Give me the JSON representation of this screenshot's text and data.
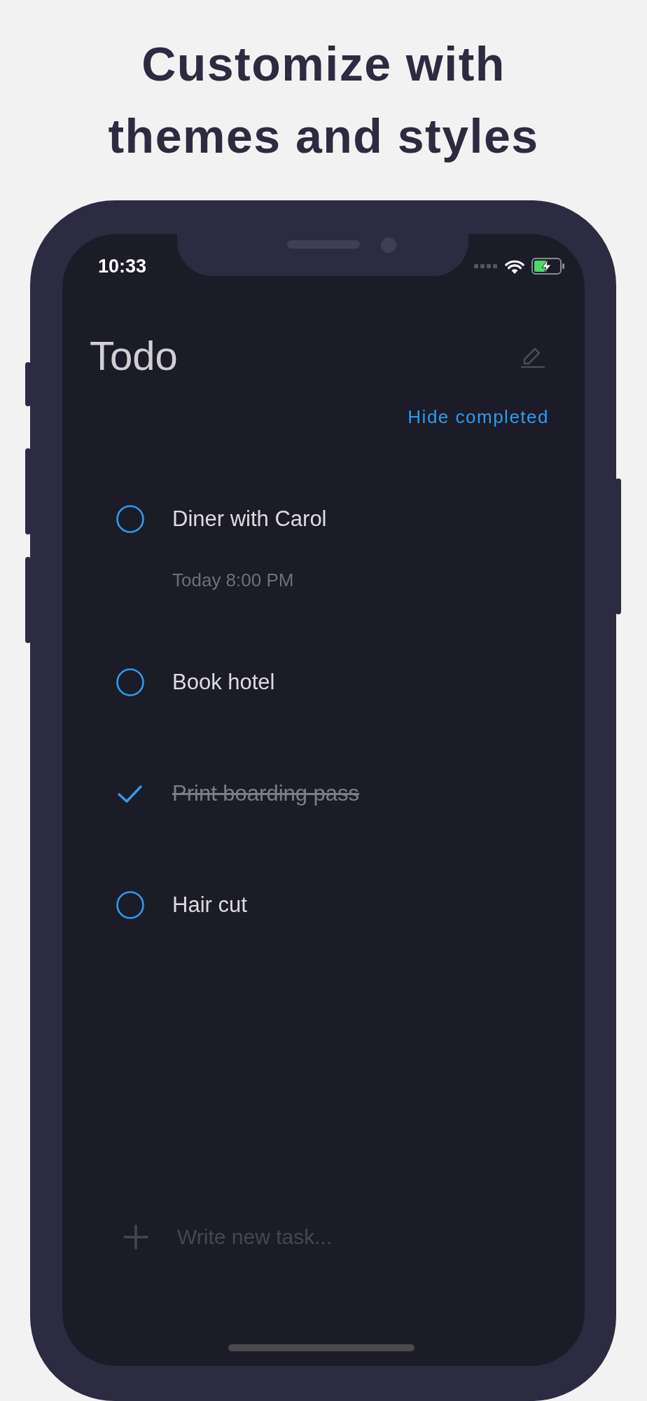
{
  "headline": "Customize with themes and styles",
  "status_bar": {
    "time": "10:33"
  },
  "header": {
    "title": "Todo",
    "filter_link": "Hide completed"
  },
  "tasks": [
    {
      "title": "Diner with Carol",
      "due": "Today 8:00 PM",
      "done": false
    },
    {
      "title": "Book hotel",
      "done": false
    },
    {
      "title": "Print boarding pass",
      "done": true
    },
    {
      "title": "Hair cut",
      "done": false
    }
  ],
  "new_task": {
    "placeholder": "Write new task..."
  }
}
